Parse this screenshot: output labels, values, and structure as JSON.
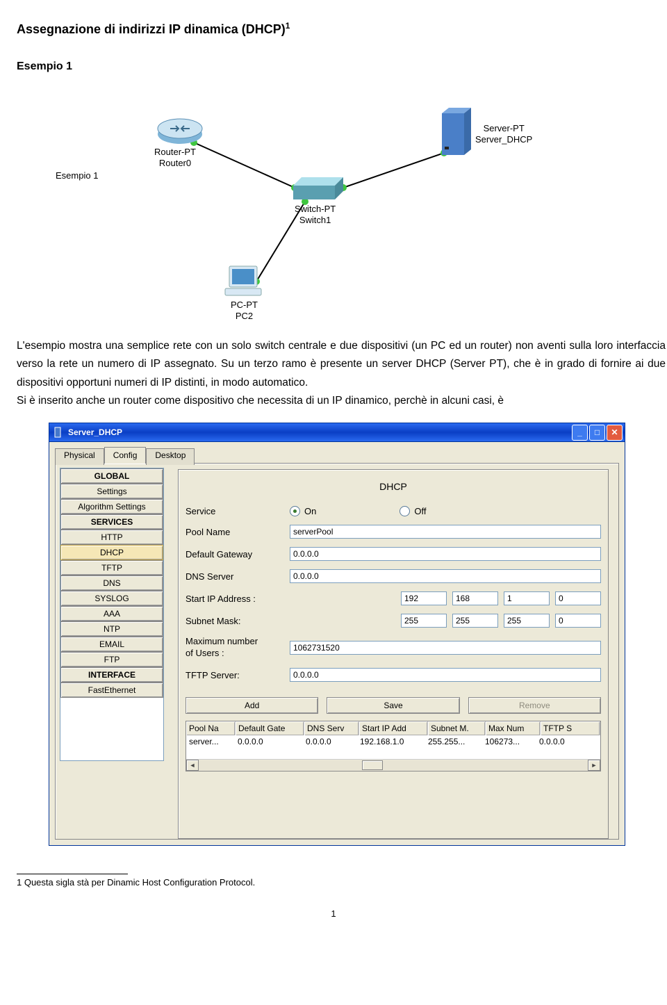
{
  "title": "Assegnazione di indirizzi IP dinamica (DHCP)",
  "title_sup": "1",
  "subtitle": "Esempio 1",
  "diagram": {
    "esempio_label": "Esempio 1",
    "router": {
      "l1": "Router-PT",
      "l2": "Router0"
    },
    "switch": {
      "l1": "Switch-PT",
      "l2": "Switch1"
    },
    "server": {
      "l1": "Server-PT",
      "l2": "Server_DHCP"
    },
    "pc": {
      "l1": "PC-PT",
      "l2": "PC2"
    }
  },
  "para1": "L'esempio mostra una semplice rete con un solo switch centrale e due dispositivi (un PC ed un router) non aventi sulla loro interfaccia verso la rete un numero di IP assegnato. Su un terzo ramo è presente un server DHCP (Server PT), che è in grado di fornire ai due dispositivi opportuni numeri di IP distinti, in modo automatico.",
  "para2": "Si è inserito anche un router come dispositivo che necessita di un IP dinamico, perchè in alcuni casi, è",
  "window": {
    "title": "Server_DHCP",
    "tabs": [
      "Physical",
      "Config",
      "Desktop"
    ],
    "left": {
      "global": "GLOBAL",
      "settings": "Settings",
      "algo": "Algorithm Settings",
      "services": "SERVICES",
      "items": [
        "HTTP",
        "DHCP",
        "TFTP",
        "DNS",
        "SYSLOG",
        "AAA",
        "NTP",
        "EMAIL",
        "FTP"
      ],
      "interface": "INTERFACE",
      "fasteth": "FastEthernet"
    },
    "form": {
      "header": "DHCP",
      "service_label": "Service",
      "on": "On",
      "off": "Off",
      "poolname_label": "Pool Name",
      "poolname": "serverPool",
      "gateway_label": "Default Gateway",
      "gateway": "0.0.0.0",
      "dns_label": "DNS Server",
      "dns": "0.0.0.0",
      "startip_label": "Start IP Address :",
      "startip": [
        "192",
        "168",
        "1",
        "0"
      ],
      "subnet_label": "Subnet Mask:",
      "subnet": [
        "255",
        "255",
        "255",
        "0"
      ],
      "maxusers_label": "Maximum number of Users :",
      "maxusers": "1062731520",
      "tftp_label": "TFTP Server:",
      "tftp": "0.0.0.0",
      "add": "Add",
      "save": "Save",
      "remove": "Remove",
      "cols": [
        "Pool Na",
        "Default Gate",
        "DNS Serv",
        "Start IP Add",
        "Subnet M.",
        "Max Num",
        "TFTP S"
      ],
      "row": [
        "server...",
        "0.0.0.0",
        "0.0.0.0",
        "192.168.1.0",
        "255.255...",
        "106273...",
        "0.0.0.0"
      ]
    }
  },
  "footnote": "1 Questa sigla stà per Dinamic Host Configuration Protocol.",
  "pagenum": "1"
}
